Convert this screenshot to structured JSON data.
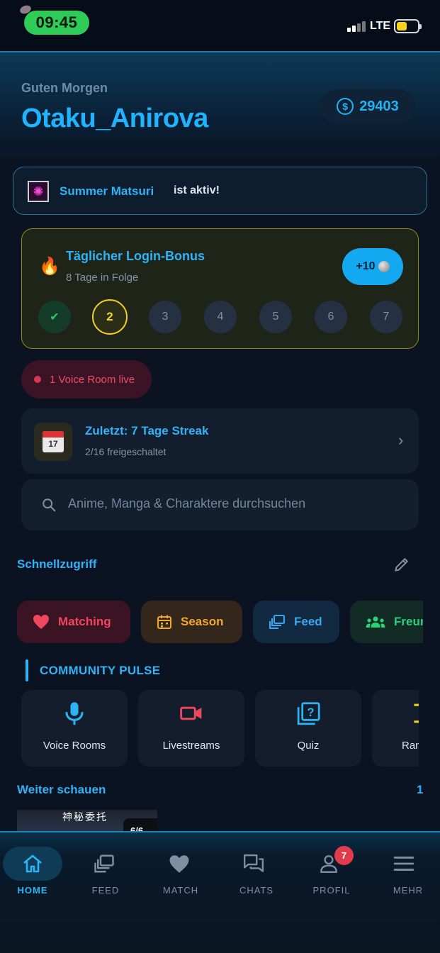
{
  "status_bar": {
    "time": "09:45",
    "network": "LTE"
  },
  "header": {
    "greeting": "Guten Morgen",
    "username": "Otaku_Anirova",
    "coin_icon": "dollar-coin-icon",
    "coins": "29403"
  },
  "event_banner": {
    "icon": "fireworks-icon",
    "name": "Summer Matsuri",
    "status": "ist aktiv!"
  },
  "login_bonus": {
    "icon": "fire-icon",
    "title": "Täglicher Login-Bonus",
    "subtitle": "8 Tage in Folge",
    "reward_label": "+10",
    "days": [
      {
        "label": "✔",
        "state": "done"
      },
      {
        "label": "2",
        "state": "current"
      },
      {
        "label": "3",
        "state": "locked"
      },
      {
        "label": "4",
        "state": "locked"
      },
      {
        "label": "5",
        "state": "locked"
      },
      {
        "label": "6",
        "state": "locked"
      },
      {
        "label": "7",
        "state": "locked"
      }
    ]
  },
  "voice_live": {
    "label": "1 Voice Room live"
  },
  "streak_card": {
    "icon_day": "17",
    "title": "Zuletzt: 7 Tage Streak",
    "subtitle": "2/16 freigeschaltet"
  },
  "search": {
    "placeholder": "Anime, Manga & Charaktere durchsuchen"
  },
  "quick_access": {
    "title": "Schnellzugriff",
    "chips": [
      {
        "label": "Matching",
        "icon": "heart-icon",
        "color": "#f0465e"
      },
      {
        "label": "Season",
        "icon": "calendar-icon",
        "color": "#f2a72c"
      },
      {
        "label": "Feed",
        "icon": "feed-icon",
        "color": "#3aa7f2"
      },
      {
        "label": "Freun",
        "icon": "friends-icon",
        "color": "#2bd07a"
      }
    ]
  },
  "community_pulse": {
    "title": "COMMUNITY PULSE",
    "tiles": [
      {
        "label": "Voice Rooms",
        "icon": "microphone-icon"
      },
      {
        "label": "Livestreams",
        "icon": "video-camera-icon"
      },
      {
        "label": "Quiz",
        "icon": "quiz-icon"
      },
      {
        "label": "Ran",
        "icon": "ranking-icon"
      }
    ]
  },
  "continue_watching": {
    "title": "Weiter schauen",
    "count": "1",
    "thumb_title": "神秘委托",
    "thumb_badge": "6/6"
  },
  "bottom_nav": {
    "items": [
      {
        "label": "HOME",
        "icon": "home-icon",
        "active": true
      },
      {
        "label": "FEED",
        "icon": "feed-icon"
      },
      {
        "label": "MATCH",
        "icon": "heart-icon"
      },
      {
        "label": "CHATS",
        "icon": "chat-icon"
      },
      {
        "label": "PROFIL",
        "icon": "profile-icon",
        "badge": "7"
      },
      {
        "label": "MEHR",
        "icon": "menu-icon"
      }
    ]
  }
}
